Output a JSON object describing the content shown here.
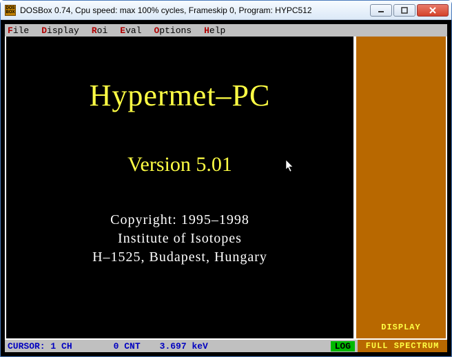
{
  "window": {
    "title": "DOSBox 0.74, Cpu speed: max 100% cycles, Frameskip  0, Program:  HYPC512",
    "icon_label": "DOS BOX"
  },
  "menu": {
    "file": {
      "hot": "F",
      "rest": "ile"
    },
    "display": {
      "hot": "D",
      "rest": "isplay"
    },
    "roi": {
      "hot": "R",
      "rest": "oi"
    },
    "eval": {
      "hot": "E",
      "rest": "val"
    },
    "options": {
      "hot": "O",
      "rest": "ptions"
    },
    "help": {
      "hot": "H",
      "rest": "elp"
    }
  },
  "splash": {
    "title": "Hypermet–PC",
    "version": "Version 5.01",
    "copyright_line1": "Copyright: 1995–1998",
    "copyright_line2": "Institute of Isotopes",
    "copyright_line3": "H–1525,  Budapest,  Hungary"
  },
  "side": {
    "line1": "DISPLAY",
    "line2": "FULL SPECTRUM"
  },
  "status": {
    "cursor": "CURSOR: 1 CH",
    "count": "0 CNT",
    "energy": "3.697 keV",
    "log": "LOG"
  },
  "colors": {
    "accent_yellow": "#ffff44",
    "side_bg": "#b86800",
    "menu_hotkey": "#b00000",
    "status_text": "#0000c0",
    "log_bg": "#00b800"
  }
}
